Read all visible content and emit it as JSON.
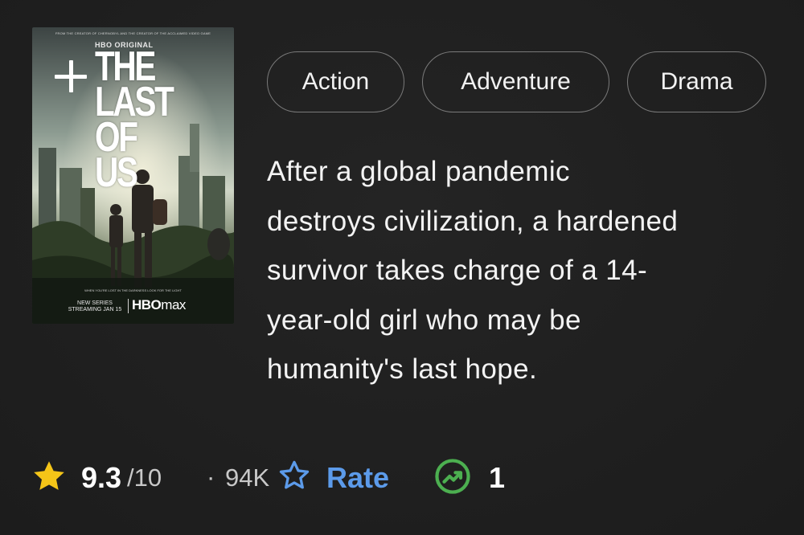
{
  "poster": {
    "tagline_top": "FROM THE CREATOR OF CHERNOBYL AND THE CREATOR OF THE ACCLAIMED VIDEO GAME",
    "network_badge": "HBO ORIGINAL",
    "title_lines": [
      "THE",
      "LAST",
      "OF US"
    ],
    "bottom_tagline": "WHEN YOU'RE LOST IN THE DARKNESS LOOK FOR THE LIGHT",
    "release_line1": "NEW SERIES",
    "release_line2": "STREAMING JAN 15",
    "streamer_hbo": "HBO",
    "streamer_max": "max"
  },
  "genres": [
    "Action",
    "Adventure",
    "Drama"
  ],
  "synopsis_lines": [
    "After a global pandemic",
    "destroys civilization, a hardened",
    "survivor takes charge of a 14-",
    "year-old girl who may be",
    "humanity's last hope."
  ],
  "rating": {
    "value": "9.3",
    "max": "/10",
    "separator": "·",
    "count": "94K",
    "star_icon": "star-filled-icon",
    "star_color": "#f5c518"
  },
  "rate": {
    "label": "Rate",
    "icon": "star-outline-icon",
    "color": "#5c9bea"
  },
  "popularity": {
    "value": "1",
    "icon": "trending-up-icon",
    "color": "#4caf50"
  },
  "add_button": {
    "icon": "plus-icon"
  }
}
